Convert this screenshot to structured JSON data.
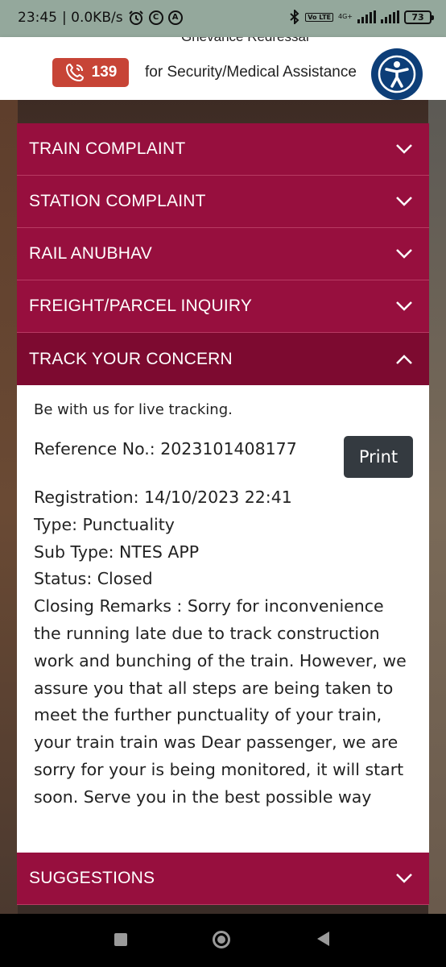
{
  "status_bar": {
    "time": "23:45",
    "network_speed": "| 0.0KB/s",
    "volte": "Vo LTE",
    "network_type": "4G+",
    "battery": "73"
  },
  "header": {
    "grievance_text": "Grievance Redressal",
    "helpline_number": "139",
    "assistance_text": "for Security/Medical Assistance",
    "accessibility_icon": "accessibility-icon"
  },
  "accordion": {
    "items": [
      {
        "label": "TRAIN COMPLAINT"
      },
      {
        "label": "STATION COMPLAINT"
      },
      {
        "label": "RAIL ANUBHAV"
      },
      {
        "label": "FREIGHT/PARCEL INQUIRY"
      },
      {
        "label": "TRACK YOUR CONCERN"
      }
    ],
    "last_item": {
      "label": "SUGGESTIONS"
    }
  },
  "tracking": {
    "intro": "Be with us for live tracking.",
    "reference": "Reference No.: 2023101408177",
    "print_label": "Print",
    "registration": "Registration: 14/10/2023 22:41",
    "type": "Type: Punctuality",
    "sub_type": "Sub Type: NTES APP",
    "status": "Status: Closed",
    "closing_remarks": "Closing Remarks : Sorry for inconvenience the running late due to track construction work and bunching of the train. However, we assure you that all steps are being taken to meet the further punctuality of your train, your train train was Dear passenger, we are sorry for your is being monitored, it will start soon. Serve you in the best possible way"
  },
  "colors": {
    "accordion_bg": "#970f3e",
    "accordion_active_bg": "#7d0a30",
    "helpline_bg": "#c74436",
    "accessibility_bg": "#0d3e78",
    "print_button_bg": "#343a40"
  }
}
